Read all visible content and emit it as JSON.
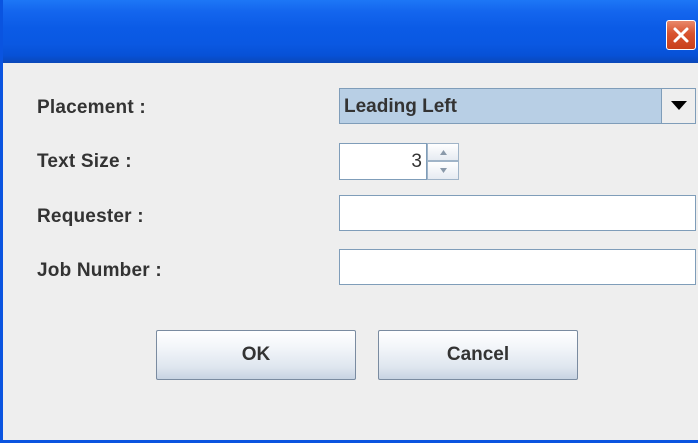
{
  "window": {
    "title": ""
  },
  "form": {
    "placement": {
      "label": "Placement :",
      "selected_value": "Leading Left"
    },
    "text_size": {
      "label": "Text Size :",
      "value": "3"
    },
    "requester": {
      "label": "Requester :",
      "value": ""
    },
    "job_number": {
      "label": "Job Number :",
      "value": ""
    }
  },
  "buttons": {
    "ok_label": "OK",
    "cancel_label": "Cancel"
  },
  "icons": {
    "close": "close-icon",
    "dropdown": "chevron-down-icon",
    "spinner_up": "spinner-up-icon",
    "spinner_down": "spinner-down-icon"
  },
  "colors": {
    "titlebar": "#0a58e2",
    "close_button": "#d9532e",
    "combo_selected": "#b8cfe5",
    "background": "#eeeeee"
  }
}
